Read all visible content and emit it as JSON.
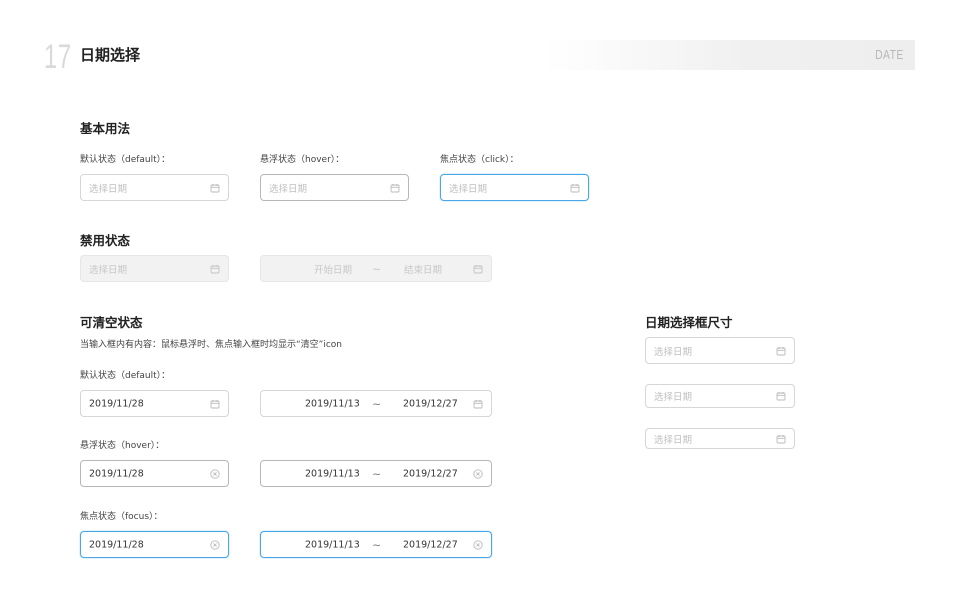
{
  "header": {
    "page_number": "17",
    "title": "日期选择",
    "tag": "DATE"
  },
  "basic": {
    "title": "基本用法",
    "default_label": "默认状态（default）：",
    "hover_label": "悬浮状态（hover）：",
    "click_label": "焦点状态（click）：",
    "placeholder": "选择日期"
  },
  "disabled": {
    "title": "禁用状态",
    "placeholder": "选择日期",
    "start_placeholder": "开始日期",
    "separator": "~",
    "end_placeholder": "结束日期"
  },
  "clearable": {
    "title": "可清空状态",
    "description": "当输入框内有内容：鼠标悬浮时、焦点输入框时均显示“清空”icon",
    "default_label": "默认状态（default）：",
    "hover_label": "悬浮状态（hover）：",
    "focus_label": "焦点状态（focus）：",
    "single_value": "2019/11/28",
    "range_start": "2019/11/13",
    "separator": "~",
    "range_end": "2019/12/27"
  },
  "sizes": {
    "title": "日期选择框尺寸",
    "placeholder": "选择日期"
  },
  "icons": {
    "calendar": "calendar-icon",
    "clear": "clear-circle-icon"
  },
  "colors": {
    "focus_border": "#49a6e8",
    "border": "#d6d6d6",
    "disabled_bg": "#f2f2f2",
    "placeholder": "#c0c0c0"
  }
}
